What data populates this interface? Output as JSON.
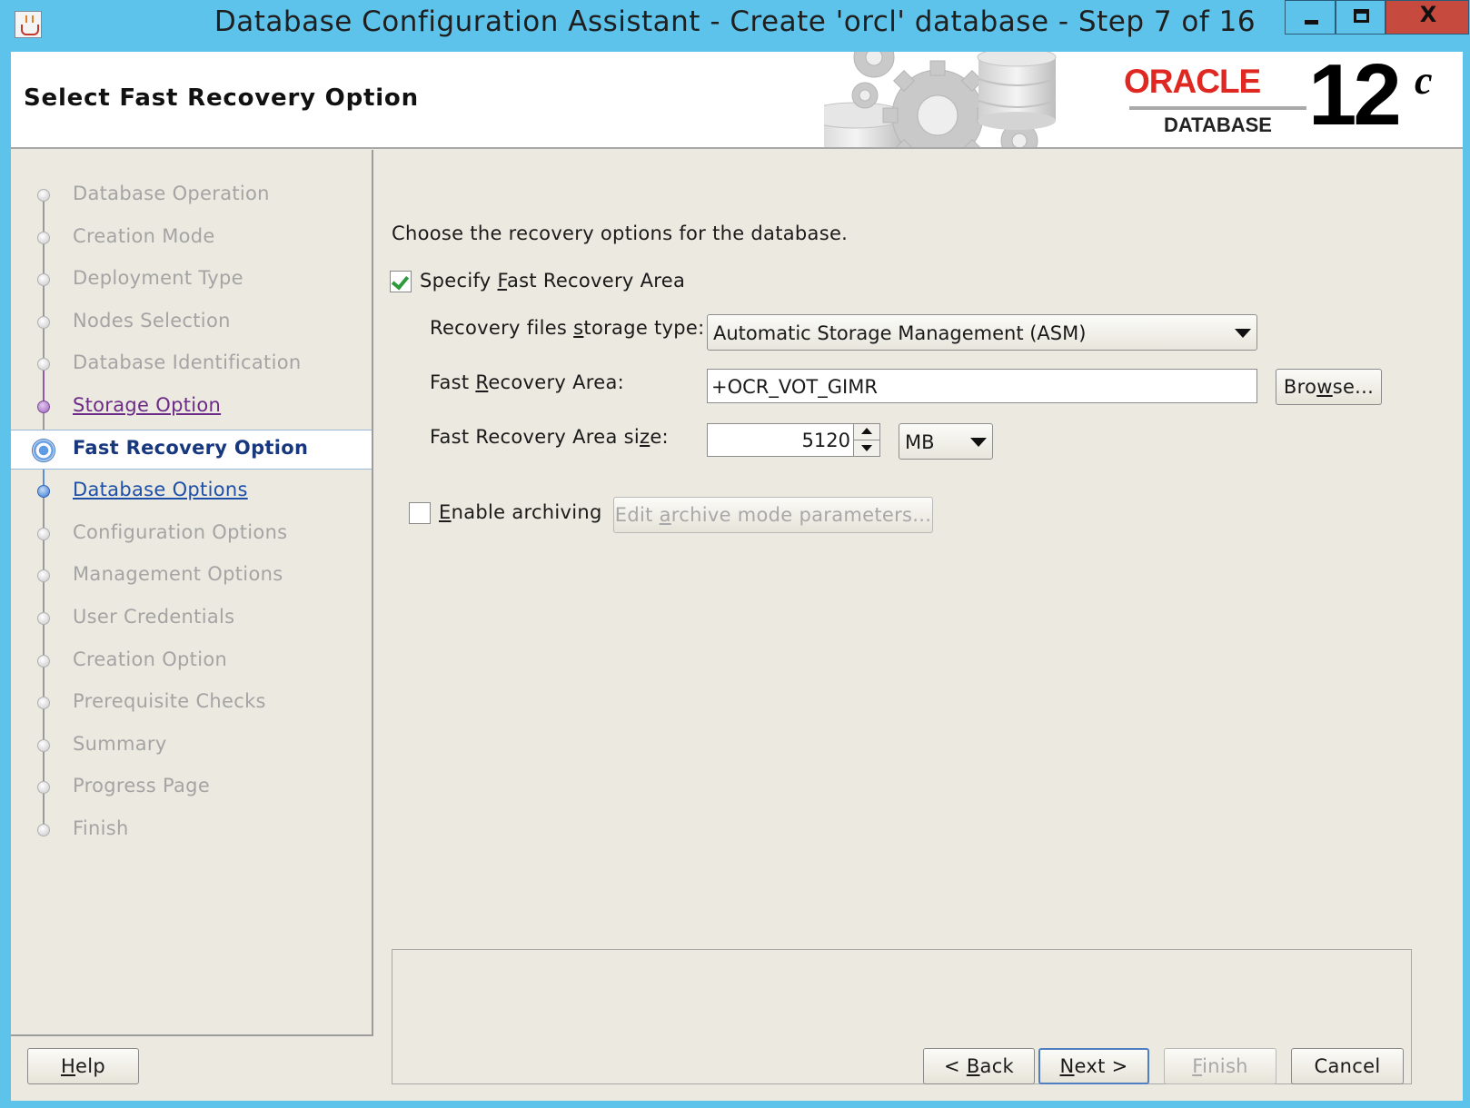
{
  "window": {
    "title": "Database Configuration Assistant - Create 'orcl' database - Step 7 of 16",
    "close_glyph": "X"
  },
  "header": {
    "page_title": "Select Fast Recovery Option",
    "logo": {
      "brand": "ORACLE",
      "product": "DATABASE",
      "version": "12",
      "version_suffix": "c",
      "brand_color": "#e02822"
    }
  },
  "steps": [
    {
      "label": "Database Operation",
      "state": "disabled"
    },
    {
      "label": "Creation Mode",
      "state": "disabled"
    },
    {
      "label": "Deployment Type",
      "state": "disabled"
    },
    {
      "label": "Nodes Selection",
      "state": "disabled"
    },
    {
      "label": "Database Identification",
      "state": "disabled"
    },
    {
      "label": "Storage Option",
      "state": "visited"
    },
    {
      "label": "Fast Recovery Option",
      "state": "current"
    },
    {
      "label": "Database Options",
      "state": "next"
    },
    {
      "label": "Configuration Options",
      "state": "disabled"
    },
    {
      "label": "Management Options",
      "state": "disabled"
    },
    {
      "label": "User Credentials",
      "state": "disabled"
    },
    {
      "label": "Creation Option",
      "state": "disabled"
    },
    {
      "label": "Prerequisite Checks",
      "state": "disabled"
    },
    {
      "label": "Summary",
      "state": "disabled"
    },
    {
      "label": "Progress Page",
      "state": "disabled"
    },
    {
      "label": "Finish",
      "state": "disabled"
    }
  ],
  "content": {
    "intro": "Choose the recovery options for the database.",
    "specify_fra": {
      "label_pre": "Specify ",
      "mnemonic": "F",
      "label_post": "ast Recovery Area",
      "checked": true
    },
    "storage_type": {
      "label_pre": "Recovery files ",
      "mnemonic": "s",
      "label_post": "torage type:",
      "value": "Automatic Storage Management (ASM)"
    },
    "fra_location": {
      "label_pre": "Fast ",
      "mnemonic": "R",
      "label_post": "ecovery Area:",
      "value": "+OCR_VOT_GIMR",
      "browse_pre": "Bro",
      "browse_mnemonic": "w",
      "browse_post": "se..."
    },
    "fra_size": {
      "label_pre": "Fast Recovery Area si",
      "mnemonic": "z",
      "label_post": "e:",
      "value": "5120",
      "unit": "MB"
    },
    "archiving": {
      "mnemonic": "E",
      "label_post": "nable archiving",
      "checked": false,
      "edit_pre": "Edit ",
      "edit_mnemonic": "a",
      "edit_post": "rchive mode parameters..."
    }
  },
  "footer": {
    "help": {
      "mnemonic": "H",
      "post": "elp"
    },
    "back": {
      "pre": "< ",
      "mnemonic": "B",
      "post": "ack"
    },
    "next": {
      "mnemonic": "N",
      "post": "ext >"
    },
    "finish": {
      "mnemonic": "F",
      "post": "inish"
    },
    "cancel": "Cancel"
  }
}
